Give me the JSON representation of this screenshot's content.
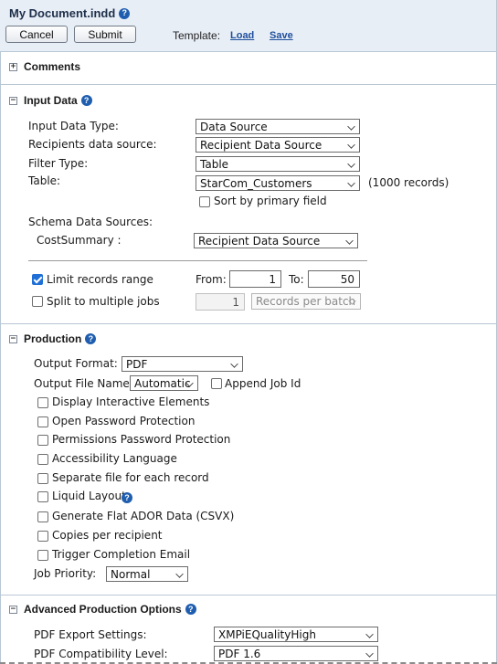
{
  "header": {
    "title": "My Document.indd",
    "cancel_label": "Cancel",
    "submit_label": "Submit",
    "template_label": "Template:",
    "load_label": "Load",
    "save_label": "Save"
  },
  "comments": {
    "title": "Comments",
    "toggle": "+"
  },
  "input_data": {
    "title": "Input Data",
    "toggle": "−",
    "input_data_type": {
      "label": "Input Data Type:",
      "value": "Data Source"
    },
    "recipients_source": {
      "label": "Recipients data source:",
      "value": "Recipient Data Source"
    },
    "filter_type": {
      "label": "Filter Type:",
      "value": "Table"
    },
    "table": {
      "label": "Table:",
      "value": "StarCom_Customers",
      "count": "(1000 records)"
    },
    "sort_primary": {
      "label": "Sort by primary field",
      "checked": false
    },
    "schema_label": "Schema Data Sources:",
    "cost_summary": {
      "label": "CostSummary :",
      "value": "Recipient Data Source"
    },
    "limit_range": {
      "label": "Limit records range",
      "checked": true,
      "from_label": "From:",
      "from": "1",
      "to_label": "To:",
      "to": "50"
    },
    "split_jobs": {
      "label": "Split to multiple jobs",
      "checked": false,
      "count": "1",
      "per_batch": "Records per batch"
    }
  },
  "production": {
    "title": "Production",
    "toggle": "−",
    "output_format": {
      "label": "Output Format:",
      "value": "PDF"
    },
    "output_file_name": {
      "label": "Output File Name:",
      "value": "Automatic",
      "append_label": "Append Job Id"
    },
    "options": [
      {
        "label": "Display Interactive Elements",
        "checked": false
      },
      {
        "label": "Open Password Protection",
        "checked": false
      },
      {
        "label": "Permissions Password Protection",
        "checked": false
      },
      {
        "label": "Accessibility Language",
        "checked": false
      },
      {
        "label": "Separate file for each record",
        "checked": false
      },
      {
        "label": "Liquid Layout",
        "checked": false
      },
      {
        "label": "Generate Flat ADOR Data (CSVX)",
        "checked": false
      },
      {
        "label": "Copies per recipient",
        "checked": false
      },
      {
        "label": "Trigger Completion Email",
        "checked": false
      }
    ],
    "job_priority": {
      "label": "Job Priority:",
      "value": "Normal"
    }
  },
  "advanced": {
    "title": "Advanced Production Options",
    "toggle": "−",
    "pdf_export": {
      "label": "PDF Export Settings:",
      "value": "XMPiEQualityHigh"
    },
    "pdf_compat": {
      "label": "PDF Compatibility Level:",
      "value": "PDF 1.6"
    }
  },
  "colors": {
    "accent": "#1f6fd6",
    "header_bg": "#e8eef6",
    "link": "#1e4f9c"
  }
}
